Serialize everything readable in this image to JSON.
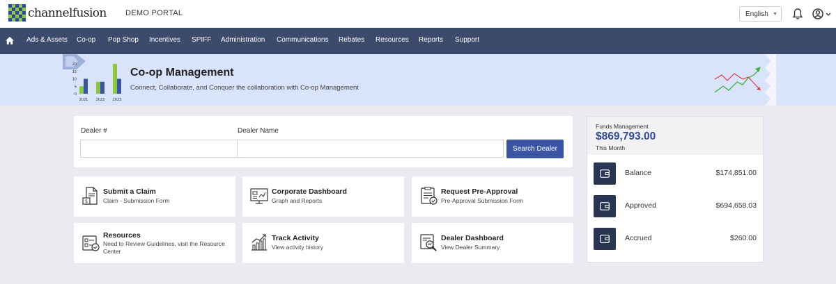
{
  "header": {
    "brand": "channelfusion",
    "portal_name": "DEMO PORTAL",
    "language": "English",
    "icons": [
      "home-icon",
      "bell-icon",
      "user-icon",
      "chevron-down-icon"
    ]
  },
  "nav": {
    "items": [
      "Ads & Assets",
      "Co-op",
      "Pop Shop",
      "Incentives",
      "SPIFF",
      "Administration",
      "Communications",
      "Rebates",
      "Resources",
      "Reports",
      "Support"
    ]
  },
  "banner": {
    "title": "Co-op Management",
    "subtitle": "Connect, Collaborate, and Conquer the collaboration with Co-op Management",
    "chart": {
      "y_ticks": [
        "20",
        "15",
        "10",
        "5",
        "0"
      ],
      "years": [
        "2021",
        "2022",
        "2023"
      ],
      "green_values": [
        5,
        8,
        20
      ],
      "blue_values": [
        10,
        8,
        10
      ]
    }
  },
  "search": {
    "dealer_number_label": "Dealer #",
    "dealer_number_value": "",
    "dealer_name_label": "Dealer Name",
    "dealer_name_value": "",
    "button": "Search Dealer"
  },
  "tiles": [
    {
      "title": "Submit a Claim",
      "description": "Claim - Submission Form",
      "icon": "claim-icon"
    },
    {
      "title": "Corporate Dashboard",
      "description": "Graph and Reports",
      "icon": "dashboard-icon"
    },
    {
      "title": "Request Pre-Approval",
      "description": "Pre-Approval Submission Form",
      "icon": "pre-approval-icon"
    },
    {
      "title": "Resources",
      "description": "Need to Review Guidelines, visit the Resource Center",
      "icon": "resources-icon"
    },
    {
      "title": "Track Activity",
      "description": "View activity history",
      "icon": "activity-icon"
    },
    {
      "title": "Dealer Dashboard",
      "description": "View Dealer Summary",
      "icon": "dealer-search-icon"
    }
  ],
  "funds": {
    "label": "Funds Management",
    "total": "$869,793.00",
    "period": "This Month",
    "rows": [
      {
        "name": "Balance",
        "value": "$174,851.00"
      },
      {
        "name": "Approved",
        "value": "$694,658.03"
      },
      {
        "name": "Accrued",
        "value": "$260.00"
      }
    ],
    "icon_color": "#283553"
  },
  "colors": {
    "nav_bg": "#3c4a6b",
    "banner_bg": "#d9e3fa",
    "accent": "#3b55a4",
    "amount": "#2e4a9e",
    "chart_green": "#8dc63f",
    "chart_blue": "#3b55a4"
  }
}
